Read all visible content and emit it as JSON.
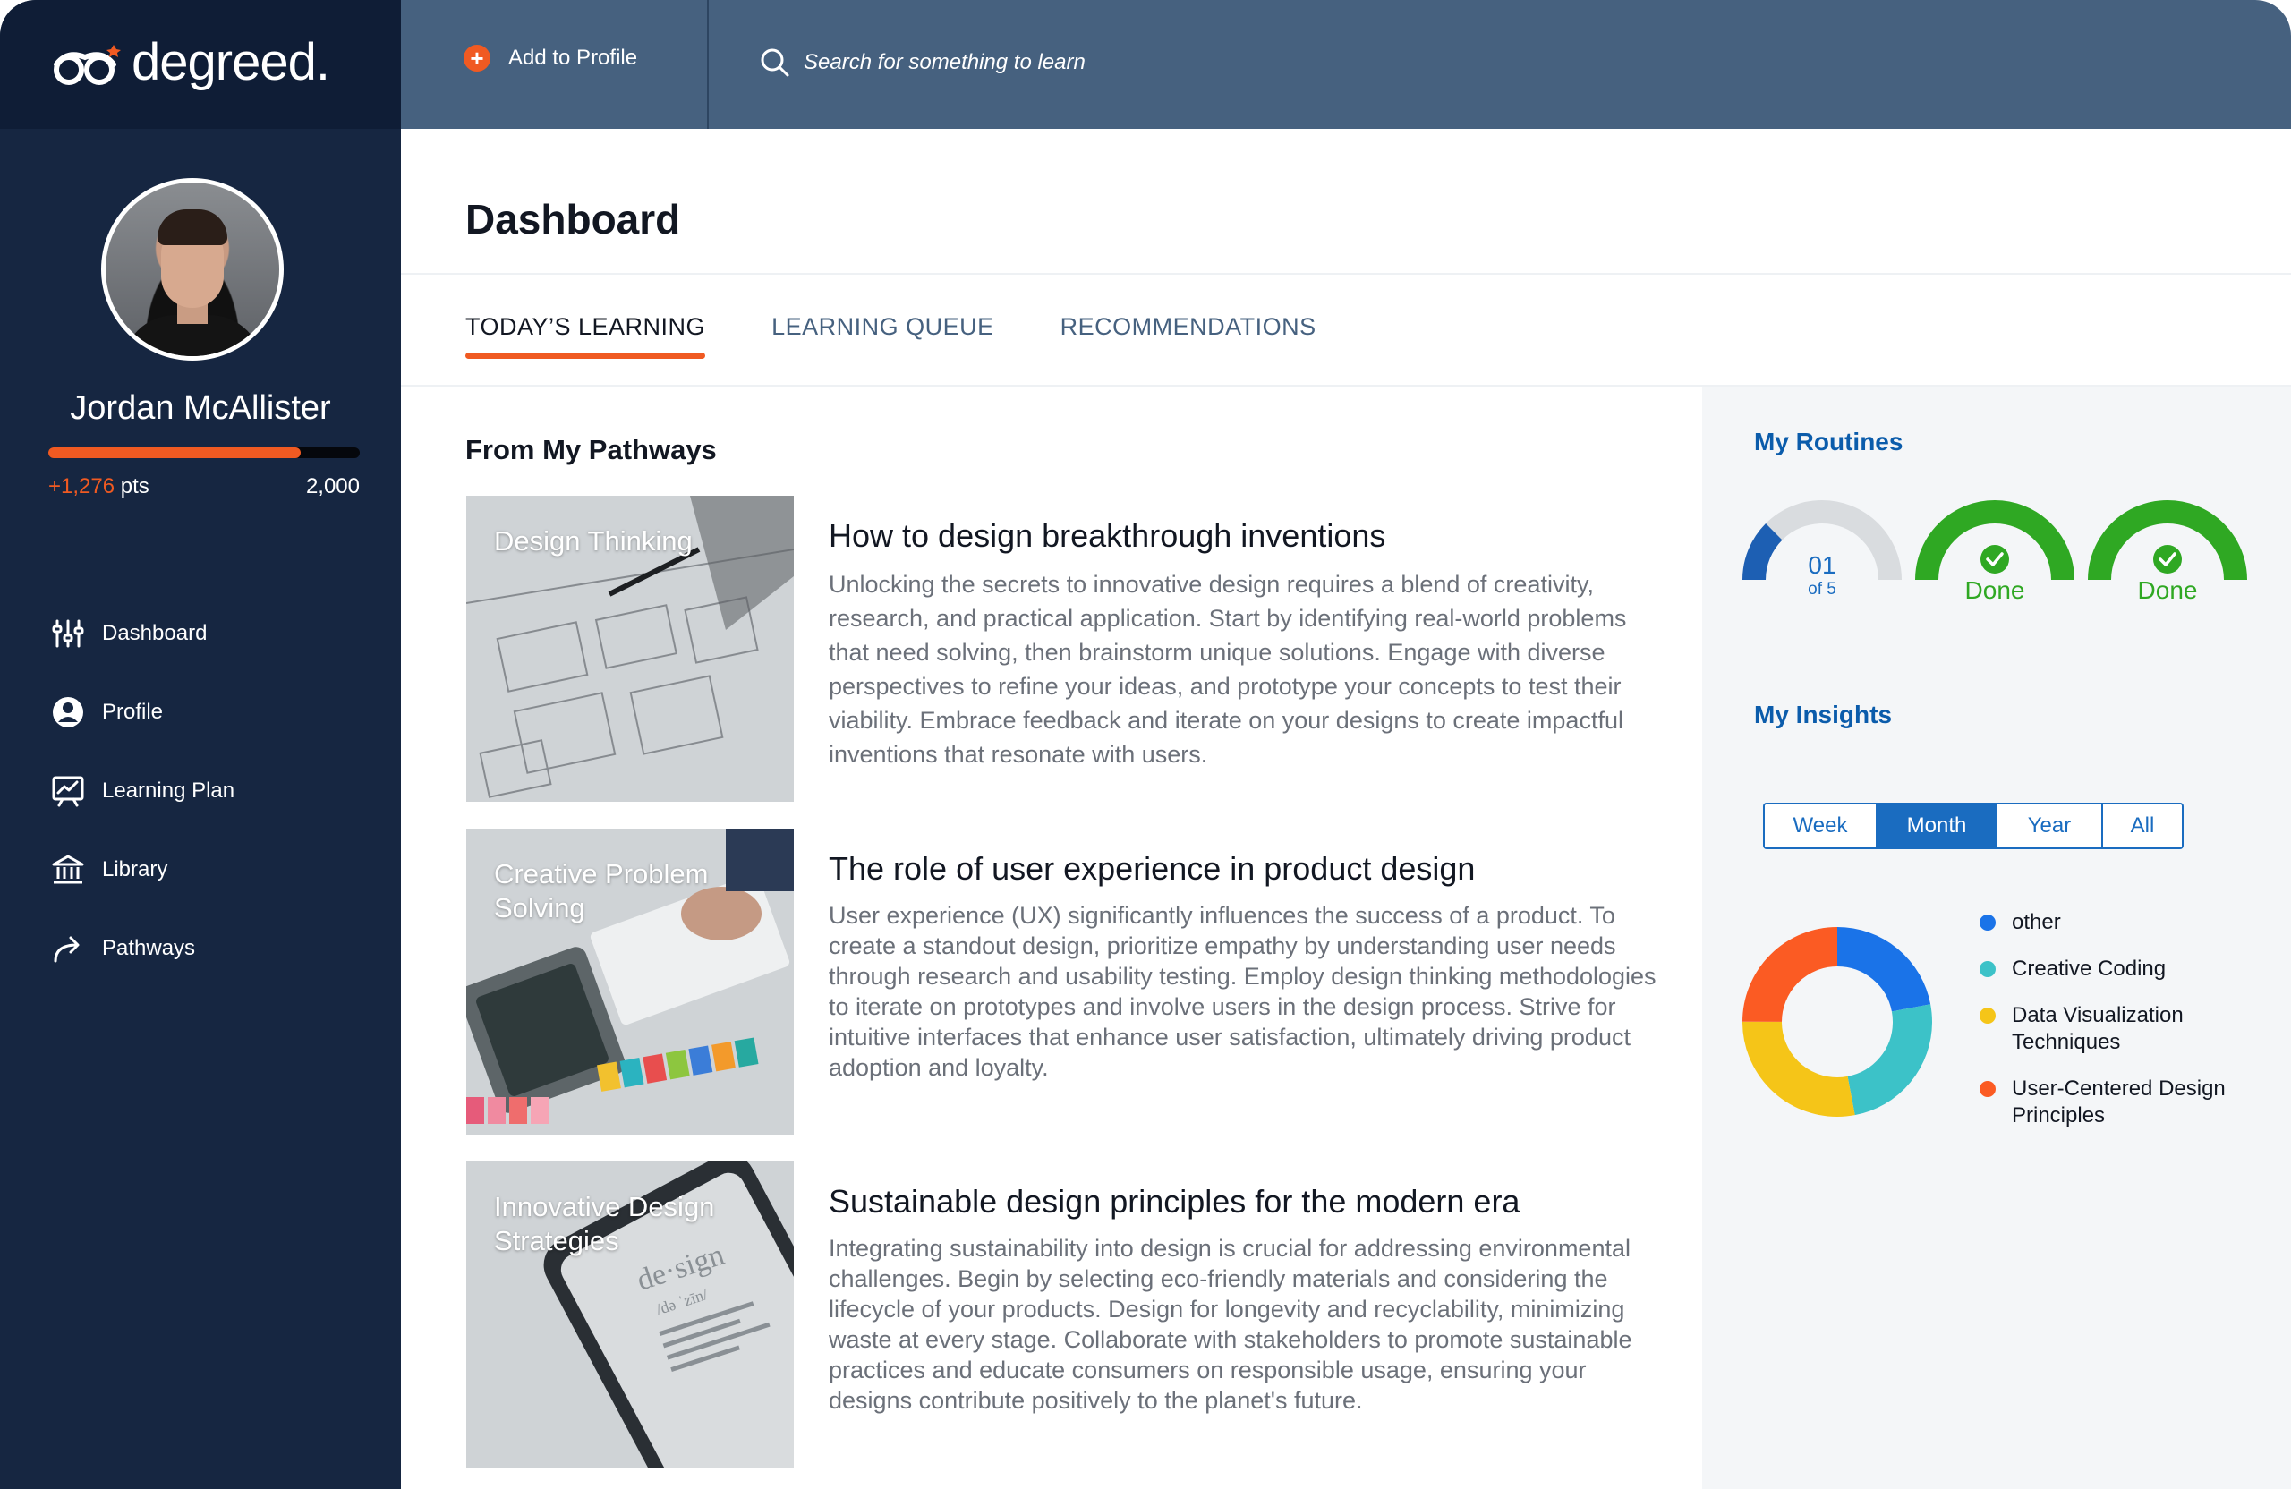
{
  "brand": {
    "name": "degreed."
  },
  "topbar": {
    "add_to_profile": "Add to Profile",
    "search_placeholder": "Search for something to learn"
  },
  "user": {
    "name": "Jordan McAllister",
    "points_gain": "+1,276",
    "points_unit": "pts",
    "points_goal": "2,000",
    "progress_fraction": 0.81
  },
  "nav": [
    {
      "label": "Dashboard",
      "icon": "sliders-icon"
    },
    {
      "label": "Profile",
      "icon": "user-circle-icon"
    },
    {
      "label": "Learning Plan",
      "icon": "chart-board-icon"
    },
    {
      "label": "Library",
      "icon": "library-icon"
    },
    {
      "label": "Pathways",
      "icon": "share-arrow-icon"
    }
  ],
  "page": {
    "title": "Dashboard",
    "tabs": [
      "TODAY’S LEARNING",
      "LEARNING QUEUE",
      "RECOMMENDATIONS"
    ],
    "active_tab": 0,
    "section_title": "From My Pathways"
  },
  "cards": [
    {
      "thumb_label": "Design Thinking",
      "title": "How to design breakthrough inventions",
      "body": "Unlocking the secrets to innovative design requires a blend of creativity, research, and practical application. Start by identifying real-world problems that need solving, then brainstorm unique solutions. Engage with diverse perspectives to refine your ideas, and prototype your concepts to test their viability. Embrace feedback and iterate on your designs to create impactful inventions that resonate with users."
    },
    {
      "thumb_label": "Creative Problem Solving",
      "title": "The role of user experience in product design",
      "body": "User experience (UX) significantly influences the success of a product. To create a standout design, prioritize empathy by understanding user needs through research and usability testing. Employ design thinking methodologies to iterate on prototypes and involve users in the design process. Strive for intuitive interfaces that enhance user satisfaction, ultimately driving product adoption and loyalty."
    },
    {
      "thumb_label": "Innovative Design Strategies",
      "thumb_overlay": "de·sign",
      "thumb_overlay_sub": "/də ˈzīn/",
      "title": "Sustainable design principles for the modern era",
      "body": "Integrating sustainability into design is crucial for addressing environmental challenges. Begin by selecting eco-friendly materials and considering the lifecycle of your products. Design for longevity and recyclability, minimizing waste at every stage. Collaborate with stakeholders to promote sustainable practices and educate consumers on responsible usage, ensuring your designs contribute positively to the planet's future."
    }
  ],
  "routines": {
    "heading": "My Routines",
    "items": [
      {
        "type": "progress",
        "value": "01",
        "sub": "of 5",
        "fraction": 0.25
      },
      {
        "type": "done",
        "label": "Done"
      },
      {
        "type": "done",
        "label": "Done"
      }
    ]
  },
  "insights": {
    "heading": "My Insights",
    "periods": [
      "Week",
      "Month",
      "Year",
      "All"
    ],
    "active_period": "Month"
  },
  "colors": {
    "accent": "#f05a22",
    "blue": "#1a6cc0",
    "done_green": "#2fa823",
    "sidebar": "#162641",
    "topbar": "#46617f"
  },
  "chart_data": {
    "type": "pie",
    "donut": true,
    "labels": [
      "other",
      "Creative Coding",
      "Data Visualization Techniques",
      "User-Centered Design Principles"
    ],
    "values": [
      22,
      25,
      28,
      25
    ],
    "colors": [
      "#1a73e8",
      "#3cc2c8",
      "#f5c518",
      "#fb5b23"
    ]
  }
}
